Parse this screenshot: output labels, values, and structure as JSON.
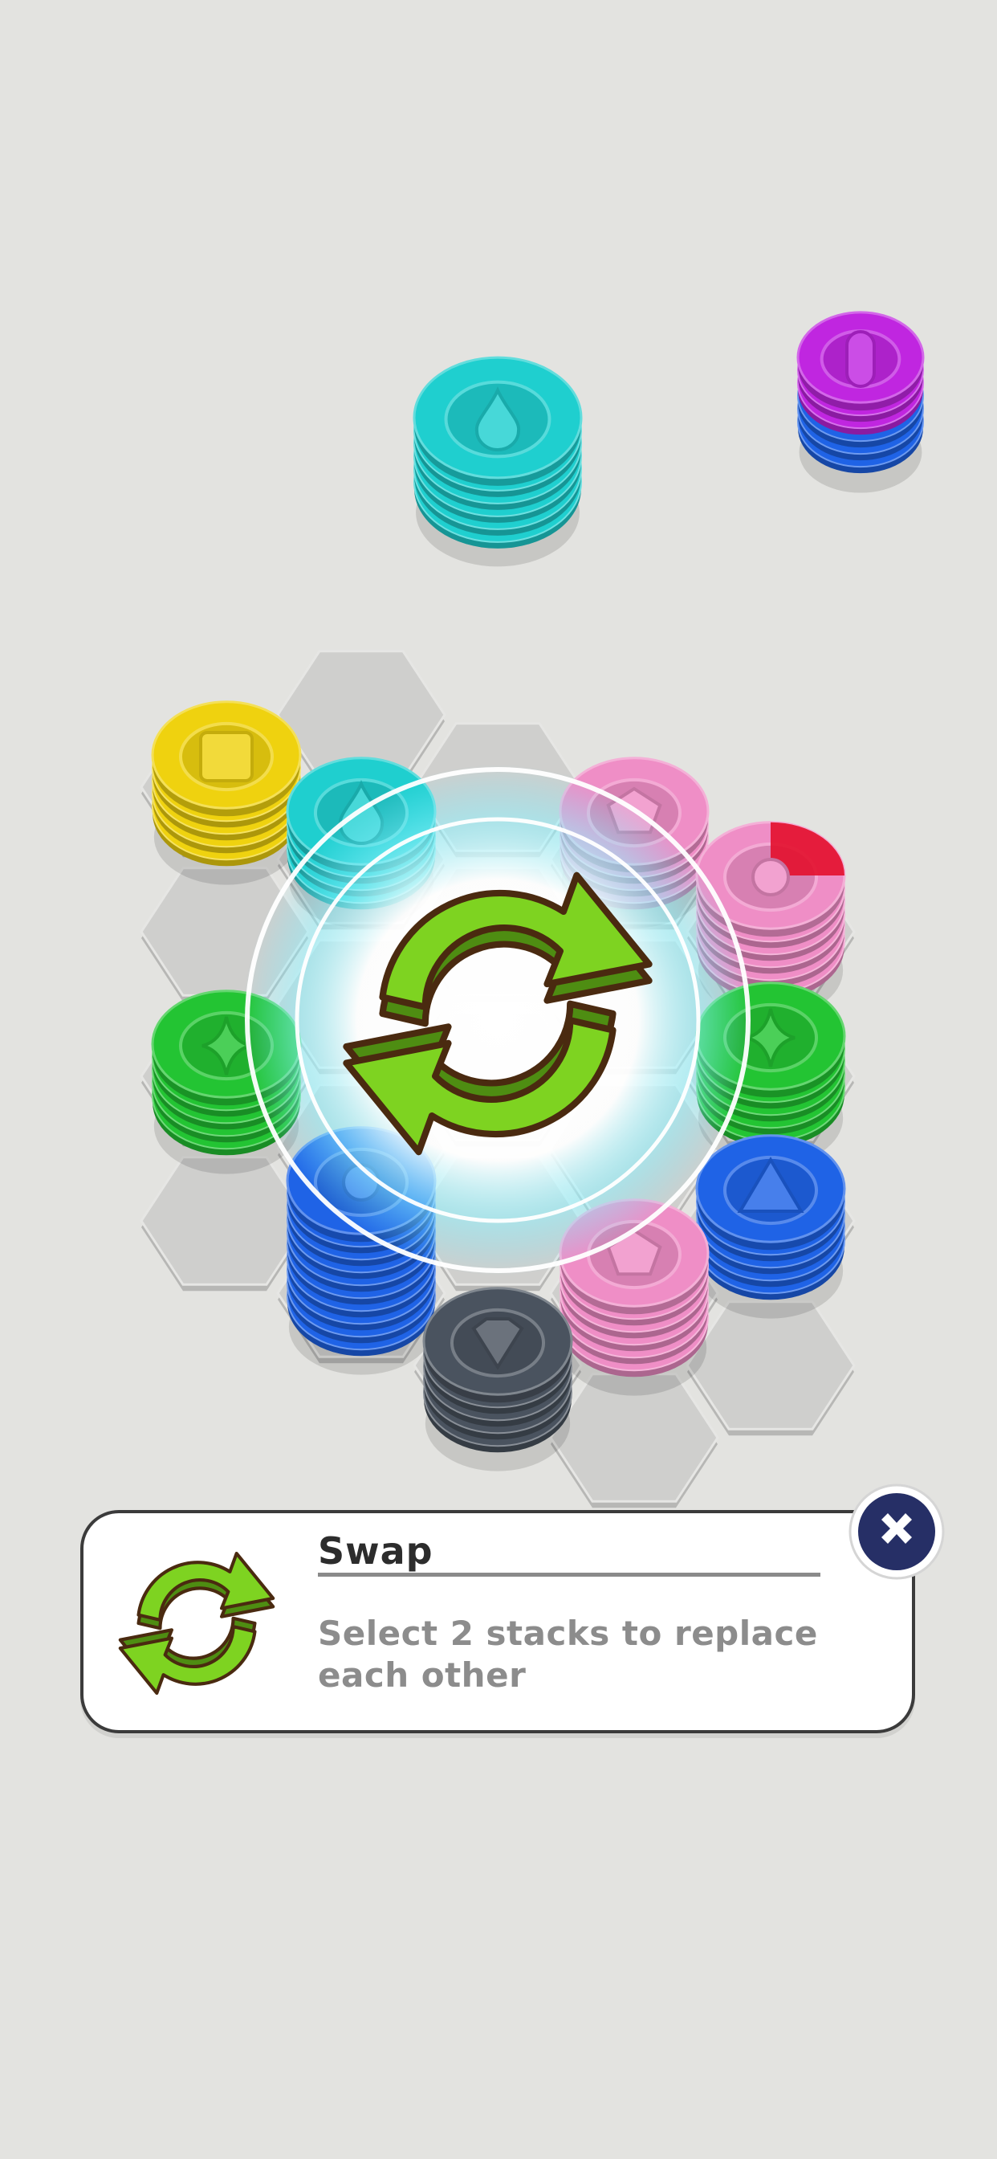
{
  "panel": {
    "title": "Swap",
    "description": "Select 2 stacks to replace each other",
    "icon": "swap-arrows-icon"
  },
  "close_button": {
    "icon": "close-x-icon"
  },
  "booster": {
    "name": "swap",
    "icon": "swap-arrows-icon"
  },
  "colors": {
    "background": "#e3e3e0",
    "tile": "#cfcfcd",
    "cyan": "#1fcfcf",
    "purple": "#c026e0",
    "blue": "#1f63e6",
    "yellow": "#efd20f",
    "green": "#23c433",
    "pink": "#ef8ec6",
    "dark": "#4a535f",
    "red": "#e3102c",
    "swap_green": "#7ed321",
    "close_navy": "#262f66"
  },
  "incoming_stacks": [
    {
      "color": "cyan",
      "layers": 6,
      "symbol": "drop"
    },
    {
      "color": "purple",
      "layers": 6,
      "symbol": "oval",
      "under": "blue"
    }
  ],
  "board_stacks": [
    {
      "color": "yellow",
      "symbol": "square",
      "layers": 5
    },
    {
      "color": "cyan",
      "symbol": "drop",
      "layers": 4
    },
    {
      "color": "pink",
      "symbol": "pentagon",
      "layers": 4
    },
    {
      "color": "pink",
      "symbol": "circle",
      "layers": 6,
      "progress": 0.25
    },
    {
      "color": "green",
      "symbol": "diamond",
      "layers": 5
    },
    {
      "color": "green",
      "symbol": "diamond",
      "layers": 5
    },
    {
      "color": "blue",
      "symbol": "triangle",
      "layers": 5
    },
    {
      "color": "blue",
      "symbol": "circle",
      "layers": 10
    },
    {
      "color": "pink",
      "symbol": "pentagon",
      "layers": 6
    },
    {
      "color": "dark",
      "symbol": "gem",
      "layers": 5
    }
  ]
}
